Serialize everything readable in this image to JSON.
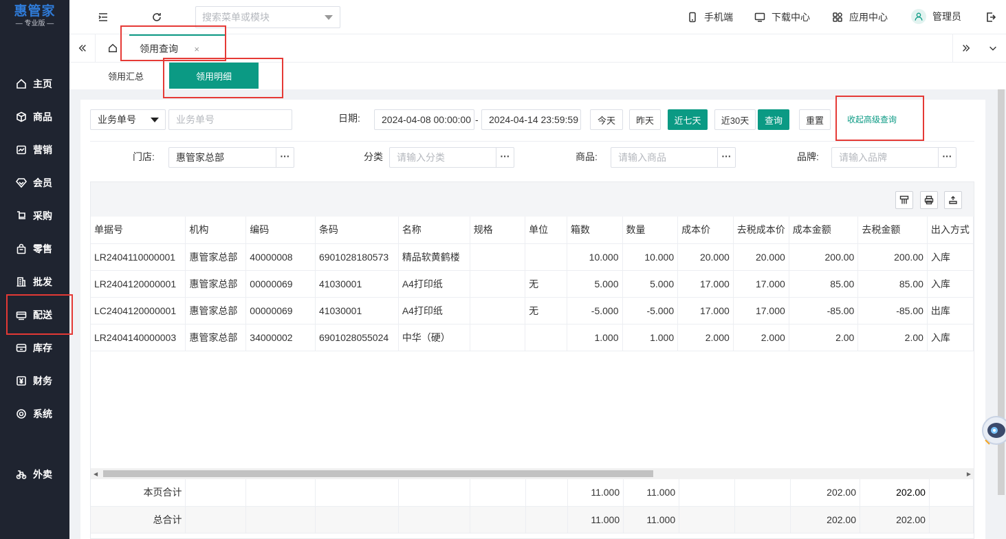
{
  "brand": {
    "title": "惠管家",
    "subtitle": "专业版"
  },
  "sidebar": {
    "items": [
      {
        "label": "主页",
        "icon": "home-icon"
      },
      {
        "label": "商品",
        "icon": "box-icon"
      },
      {
        "label": "营销",
        "icon": "chart-icon"
      },
      {
        "label": "会员",
        "icon": "diamond-icon"
      },
      {
        "label": "采购",
        "icon": "cart-icon"
      },
      {
        "label": "零售",
        "icon": "bag-icon"
      },
      {
        "label": "批发",
        "icon": "building-icon"
      },
      {
        "label": "配送",
        "icon": "truck-icon"
      },
      {
        "label": "库存",
        "icon": "inventory-icon"
      },
      {
        "label": "财务",
        "icon": "yuan-icon"
      },
      {
        "label": "系统",
        "icon": "settings-icon"
      },
      {
        "label": "外卖",
        "icon": "bike-icon"
      }
    ]
  },
  "topbar": {
    "search_placeholder": "搜索菜单或模块",
    "mobile": "手机端",
    "download": "下载中心",
    "apps": "应用中心",
    "user": "管理员"
  },
  "tabs": {
    "active": "领用查询",
    "close": "×"
  },
  "subtabs": {
    "summary": "领用汇总",
    "detail": "领用明细"
  },
  "filters": {
    "doc_type": "业务单号",
    "doc_placeholder": "业务单号",
    "date_label": "日期:",
    "date_start": "2024-04-08 00:00:00",
    "date_sep": "-",
    "date_end": "2024-04-14 23:59:59",
    "btn_today": "今天",
    "btn_yesterday": "昨天",
    "btn_7days": "近七天",
    "btn_30days": "近30天",
    "btn_query": "查询",
    "btn_reset": "重置",
    "collapse_link": "收起高级查询",
    "store_label": "门店:",
    "store_value": "惠管家总部",
    "category_label": "分类",
    "category_placeholder": "请输入分类",
    "product_label": "商品:",
    "product_placeholder": "请输入商品",
    "brand_label": "品牌:",
    "brand_placeholder": "请输入品牌",
    "dots": "···"
  },
  "table": {
    "columns": [
      "单据号",
      "机构",
      "编码",
      "条码",
      "名称",
      "规格",
      "单位",
      "箱数",
      "数量",
      "成本价",
      "去税成本价",
      "成本金额",
      "去税金额",
      "出入方式"
    ],
    "rows": [
      [
        "LR2404110000001",
        "惠管家总部",
        "40000008",
        "6901028180573",
        "精品软黄鹤楼",
        "",
        "",
        "10.000",
        "10.000",
        "20.000",
        "20.000",
        "200.00",
        "200.00",
        "入库"
      ],
      [
        "LR2404120000001",
        "惠管家总部",
        "00000069",
        "41030001",
        "A4打印纸",
        "",
        "无",
        "5.000",
        "5.000",
        "17.000",
        "17.000",
        "85.00",
        "85.00",
        "入库"
      ],
      [
        "LC2404120000001",
        "惠管家总部",
        "00000069",
        "41030001",
        "A4打印纸",
        "",
        "无",
        "-5.000",
        "-5.000",
        "17.000",
        "17.000",
        "-85.00",
        "-85.00",
        "出库"
      ],
      [
        "LR2404140000003",
        "惠管家总部",
        "34000002",
        "6901028055024",
        "中华（硬）",
        "",
        "",
        "1.000",
        "1.000",
        "2.000",
        "2.000",
        "2.00",
        "2.00",
        "入库"
      ]
    ],
    "page_total": {
      "label": "本页合计",
      "boxes": "11.000",
      "qty": "11.000",
      "cost_amount": "202.00",
      "net_amount": "202.00"
    },
    "grand_total": {
      "label": "总合计",
      "boxes": "11.000",
      "qty": "11.000",
      "cost_amount": "202.00",
      "net_amount": "202.00"
    }
  },
  "colors": {
    "accent": "#0b9a84",
    "sidebar": "#1f2430",
    "highlight": "#e53935"
  }
}
